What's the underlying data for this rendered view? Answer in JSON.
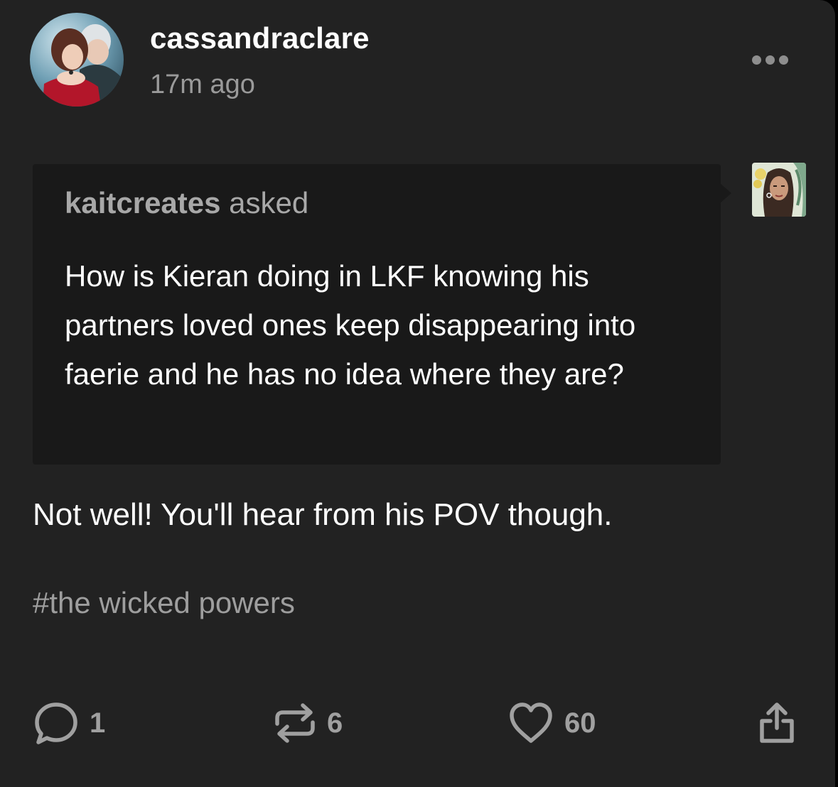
{
  "post": {
    "author": "cassandraclare",
    "timestamp": "17m ago",
    "ask": {
      "asker": "kaitcreates",
      "verb": "asked",
      "question": "How is Kieran doing in LKF knowing his partners loved ones keep disappearing into faerie and he has no idea where they are?"
    },
    "answer": "Not well! You'll hear from his POV though.",
    "tags": [
      "#the wicked powers"
    ]
  },
  "actions": {
    "reply_count": "1",
    "reblog_count": "6",
    "like_count": "60"
  },
  "icons": {
    "more": "more-dots-icon",
    "reply": "speech-bubble-icon",
    "reblog": "reblog-arrows-icon",
    "like": "heart-icon",
    "share": "share-icon"
  },
  "colors": {
    "background": "#222222",
    "ask_background": "#191919",
    "text_primary": "#ffffff",
    "text_secondary": "#9a9a9a"
  }
}
